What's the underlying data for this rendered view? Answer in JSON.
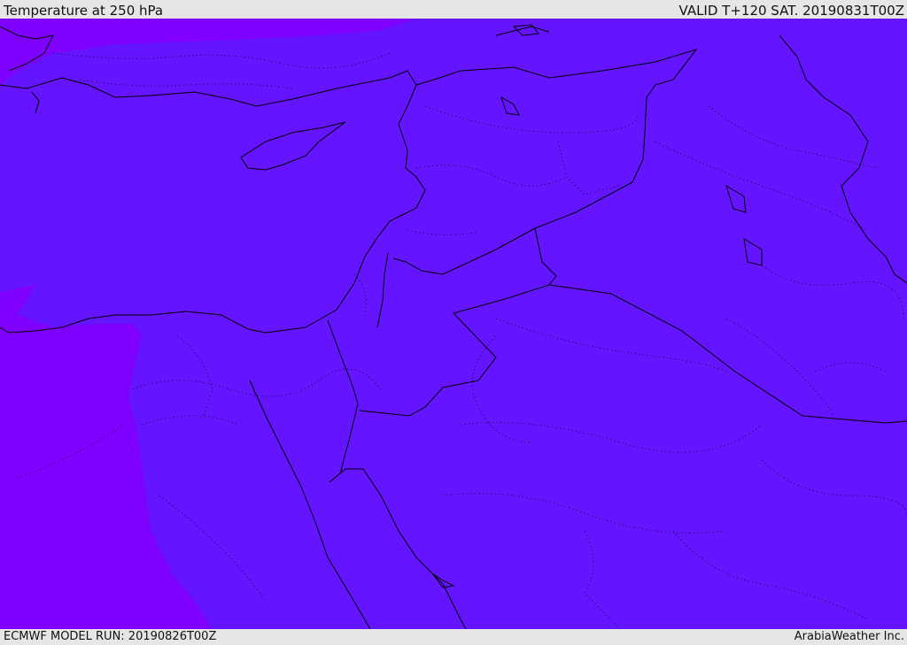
{
  "header": {
    "title": "Temperature at 250 hPa",
    "valid": "VALID T+120 SAT. 20190831T00Z"
  },
  "footer": {
    "model_run": "ECMWF MODEL RUN: 20190826T00Z",
    "credit": "ArabiaWeather Inc."
  },
  "map": {
    "field": "Temperature",
    "level": "250 hPa",
    "colors": {
      "main_shade": "#6414ff",
      "colder_shade": "#8000ff",
      "coastline": "#000000",
      "borders": "#000000"
    }
  }
}
